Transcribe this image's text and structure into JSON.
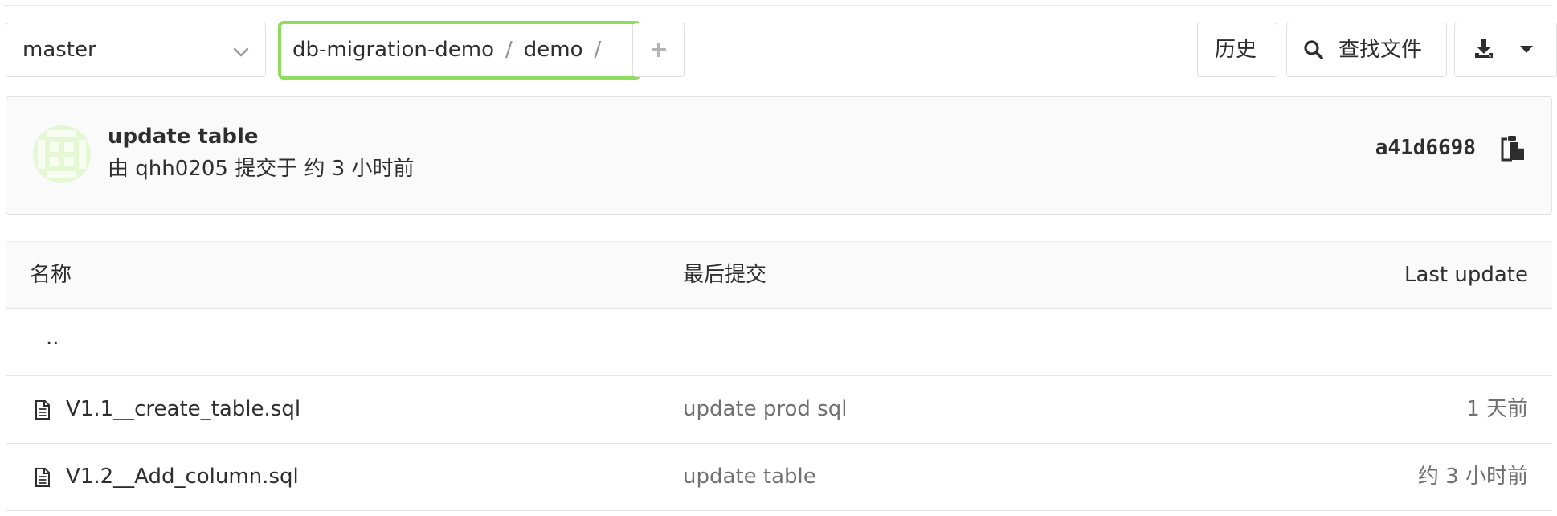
{
  "toolbar": {
    "branch": "master",
    "breadcrumb": [
      "db-migration-demo",
      "demo"
    ],
    "breadcrumb_separator": "/",
    "history_label": "历史",
    "find_file_label": "查找文件"
  },
  "commit": {
    "title": "update table",
    "author_prefix": "由",
    "author": "qhh0205",
    "time_text": "提交于 约 3 小时前",
    "sha": "a41d6698"
  },
  "table": {
    "headers": {
      "name": "名称",
      "last_commit": "最后提交",
      "last_update": "Last update"
    },
    "parent_dir": "..",
    "rows": [
      {
        "name": "V1.1__create_table.sql",
        "last_commit": "update prod sql",
        "last_update": "1 天前"
      },
      {
        "name": "V1.2__Add_column.sql",
        "last_commit": "update table",
        "last_update": "约 3 小时前"
      }
    ]
  },
  "icons": {
    "chevron": "chevron-down-icon",
    "add": "plus-icon",
    "search": "search-icon",
    "download": "download-icon",
    "caret": "caret-down-icon",
    "copy": "copy-icon",
    "file": "file-text-icon"
  },
  "colors": {
    "highlight": "#8ddc5d",
    "avatar_bg": "#e6f8d3",
    "muted_text": "#707070"
  }
}
